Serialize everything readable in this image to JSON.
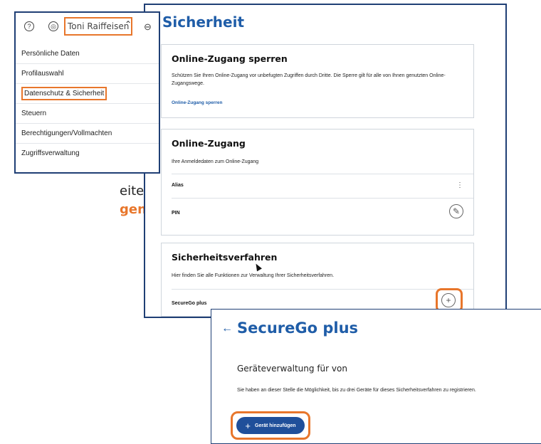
{
  "background_text": {
    "line1": "eite",
    "line2_accent": "gen",
    "line2_suffix": "."
  },
  "header": {
    "user_name": "Toni Raiffeisen"
  },
  "menu": {
    "items": [
      {
        "label": "Persönliche Daten"
      },
      {
        "label": "Profilauswahl"
      },
      {
        "label": "Datenschutz & Sicherheit"
      },
      {
        "label": "Steuern"
      },
      {
        "label": "Berechtigungen/Vollmachten"
      },
      {
        "label": "Zugriffsverwaltung"
      }
    ]
  },
  "sicherheit": {
    "title": "Sicherheit",
    "card_sperren": {
      "title": "Online-Zugang sperren",
      "desc": "Schützen Sie Ihren Online-Zugang vor unbefugten Zugriffen durch Dritte. Die Sperre gilt für alle von Ihnen genutzten Online-Zugangswege.",
      "link": "Online-Zugang sperren"
    },
    "card_zugang": {
      "title": "Online-Zugang",
      "desc": "Ihre Anmeldedaten zum Online-Zugang",
      "row1": "Alias",
      "row2": "PIN"
    },
    "card_verfahren": {
      "title": "Sicherheitsverfahren",
      "desc": "Hier finden Sie alle Funktionen zur Verwaltung Ihrer Sicherheitsverfahren.",
      "row1": "SecureGo plus"
    }
  },
  "securego": {
    "title": "SecureGo plus",
    "subtitle": "Geräteverwaltung für von",
    "desc": "Sie haben an dieser Stelle die Möglichkeit, bis zu drei Geräte für dieses Sicherheitsverfahren zu registrieren.",
    "add_button": "Gerät hinzufügen"
  },
  "colors": {
    "accent_orange": "#e8762b",
    "brand_blue": "#1f5da8",
    "frame_navy": "#1f3f75"
  }
}
